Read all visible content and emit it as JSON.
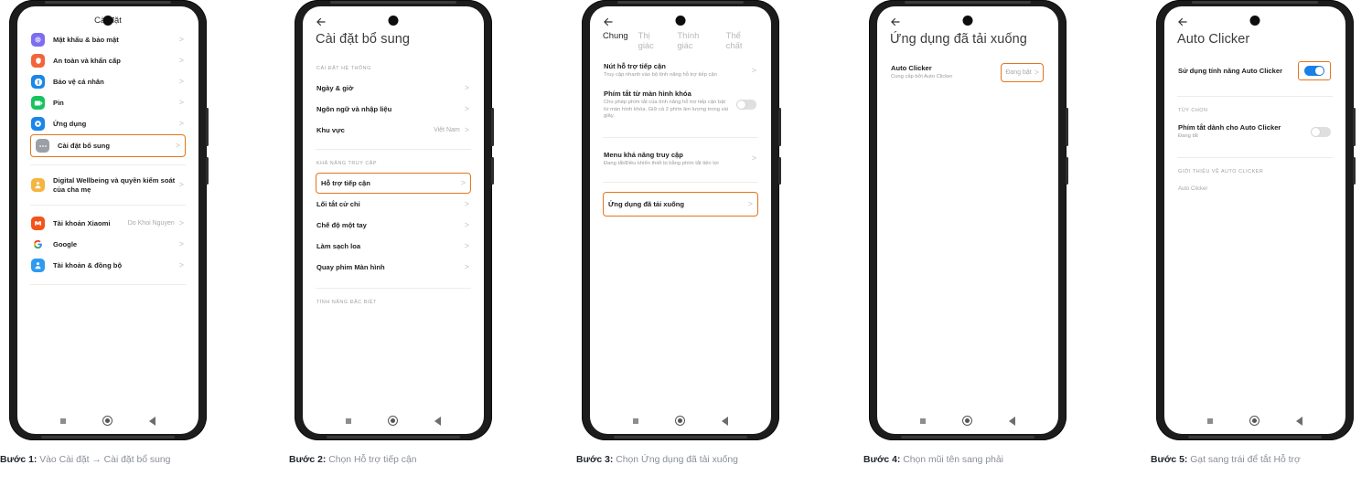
{
  "phones": [
    {
      "id": "phone-settings",
      "header_style": "center",
      "title": "Cài đặt",
      "has_back": false,
      "rows": [
        {
          "label": "Mật khẩu & bảo mật",
          "icon": "fingerprint-icon",
          "color": "#7e6df0",
          "chevron": ">"
        },
        {
          "label": "An toàn và khẩn cấp",
          "icon": "safety-icon",
          "color": "#f3643b",
          "chevron": ">"
        },
        {
          "label": "Bảo vệ cá nhân",
          "icon": "privacy-icon",
          "color": "#1a86e8",
          "chevron": ">"
        },
        {
          "label": "Pin",
          "icon": "battery-icon",
          "color": "#16c45f",
          "chevron": ">"
        },
        {
          "label": "Ứng dụng",
          "icon": "apps-icon",
          "color": "#1a86e8",
          "chevron": ">"
        },
        {
          "label": "Cài đặt bổ sung",
          "icon": "more-settings-icon",
          "color": "#9aa0a6",
          "chevron": ">",
          "highlight": true
        },
        {
          "label": "Digital Wellbeing và quyền kiểm soát của cha mẹ",
          "icon": "wellbeing-icon",
          "color": "#f5b53f",
          "chevron": ">",
          "before_divider": true
        },
        {
          "label": "Tài khoản Xiaomi",
          "value": "Do Khoi Nguyen",
          "icon": "mi-icon",
          "color": "#f2541b",
          "chevron": ">",
          "before_divider": true
        },
        {
          "label": "Google",
          "icon": "google-icon",
          "color": "#ffffff",
          "chevron": ">"
        },
        {
          "label": "Tài khoản & đồng bộ",
          "icon": "account-sync-icon",
          "color": "#2e9bf0",
          "chevron": ">"
        }
      ]
    },
    {
      "id": "phone-additional-settings",
      "header_style": "large",
      "title": "Cài đặt bổ sung",
      "has_back": true,
      "sections": [
        {
          "label": "CÀI ĐẶT HỆ THỐNG",
          "rows": [
            {
              "label": "Ngày & giờ",
              "chevron": ">"
            },
            {
              "label": "Ngôn ngữ và nhập liệu",
              "chevron": ">"
            },
            {
              "label": "Khu vực",
              "value": "Việt Nam",
              "chevron": ">"
            }
          ]
        },
        {
          "label": "KHẢ NĂNG TRUY CẬP",
          "rows": [
            {
              "label": "Hỗ trợ tiếp cận",
              "chevron": ">",
              "highlight": true
            },
            {
              "label": "Lối tắt cử chỉ",
              "chevron": ">"
            },
            {
              "label": "Chế độ một tay",
              "chevron": ">"
            },
            {
              "label": "Làm sạch loa",
              "chevron": ">"
            },
            {
              "label": "Quay phim Màn hình",
              "chevron": ">"
            }
          ]
        },
        {
          "label": "TÍNH NĂNG ĐẶC BIỆT",
          "rows": []
        }
      ]
    },
    {
      "id": "phone-accessibility",
      "header_style": "tabs",
      "has_back": true,
      "tabs": [
        {
          "label": "Chung",
          "active": true
        },
        {
          "label": "Thị giác",
          "active": false
        },
        {
          "label": "Thính giác",
          "active": false
        },
        {
          "label": "Thể chất",
          "active": false
        }
      ],
      "rows": [
        {
          "label": "Nút hỗ trợ tiếp cận",
          "sub": "Truy cập nhanh vào bộ tính năng hỗ trợ tiếp cận",
          "chevron": ">"
        },
        {
          "label": "Phím tắt từ màn hình khóa",
          "sub": "Cho phép phím tắt của tính năng hỗ trợ tiếp cận bật từ màn hình khóa. Giữ cả 2 phím âm lượng trong vài giây.",
          "toggle": "off"
        },
        {
          "label": "Menu khả năng truy cập",
          "sub": "Đang tắt/Điều khiển thiết bị bằng phím tắt tiện lợi",
          "chevron": ">",
          "before_divider": true
        },
        {
          "label": "Ứng dụng đã tải xuống",
          "chevron": ">",
          "highlight": true,
          "before_divider": true
        }
      ]
    },
    {
      "id": "phone-downloaded-apps",
      "header_style": "large",
      "title": "Ứng dụng đã tải xuống",
      "has_back": true,
      "rows": [
        {
          "label": "Auto Clicker",
          "sub": "Cung cấp bởi Auto Clicker",
          "badge": "Đang bật",
          "chevron": ">",
          "badge_highlight": true
        }
      ]
    },
    {
      "id": "phone-auto-clicker",
      "header_style": "large",
      "title": "Auto Clicker",
      "has_back": true,
      "rows": [
        {
          "label": "Sử dụng tính năng Auto Clicker",
          "toggle": "on",
          "toggle_highlight": true
        }
      ],
      "sections": [
        {
          "label": "TÙY CHỌN",
          "rows": [
            {
              "label": "Phím tắt dành cho Auto Clicker",
              "sub": "Đang tắt",
              "toggle": "off"
            }
          ]
        },
        {
          "label": "GIỚI THIỆU VỀ AUTO CLICKER",
          "plain": "Auto Clicker"
        }
      ]
    }
  ],
  "captions": [
    {
      "step": "Bước 1:",
      "text": " Vào Cài đặt → Cài đặt bổ sung"
    },
    {
      "step": "Bước 2:",
      "text": " Chọn Hỗ trợ tiếp cận"
    },
    {
      "step": "Bước 3:",
      "text": " Chọn Ứng dụng đã tải xuống"
    },
    {
      "step": "Bước 4:",
      "text": " Chọn mũi tên sang phải"
    },
    {
      "step": "Bước 5:",
      "text": " Gạt sang trái để tắt Hỗ trợ"
    }
  ],
  "nav": {
    "recents": "recents-square-icon",
    "home": "home-circle-icon",
    "back": "back-triangle-icon"
  },
  "colors": {
    "highlight": "#e3761c",
    "toggle_on": "#1a80e8",
    "toggle_off": "#dfdfdf"
  }
}
